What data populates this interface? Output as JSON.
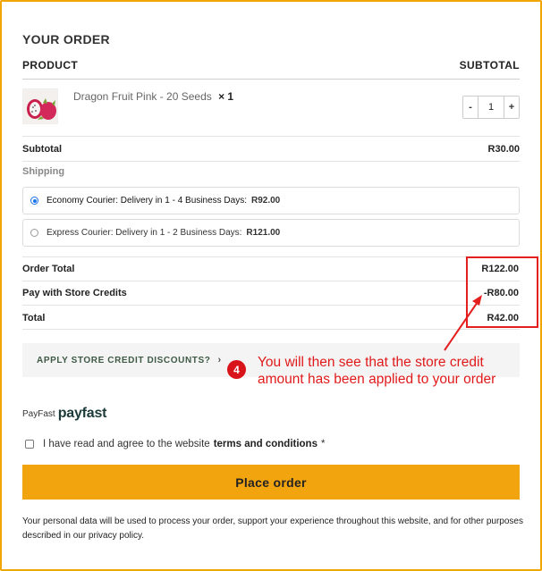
{
  "order": {
    "title": "YOUR ORDER",
    "col_product": "PRODUCT",
    "col_subtotal": "SUBTOTAL"
  },
  "product": {
    "name": "Dragon Fruit Pink - 20 Seeds",
    "qty_label": "× 1",
    "stepper_minus": "-",
    "stepper_value": "1",
    "stepper_plus": "+",
    "image_icon": "dragon-fruit-thumbnail"
  },
  "totals": {
    "subtotal_label": "Subtotal",
    "subtotal_value": "R30.00",
    "shipping_label": "Shipping",
    "order_total_label": "Order Total",
    "order_total_value": "R122.00",
    "store_credit_label": "Pay with Store Credits",
    "store_credit_value": "-R80.00",
    "total_label": "Total",
    "total_value": "R42.00"
  },
  "shipping_options": [
    {
      "name": "Economy Courier: Delivery in 1 - 4 Business Days:",
      "price": "R92.00",
      "selected": true
    },
    {
      "name": "Express Courier: Delivery in 1 - 2 Business Days:",
      "price": "R121.00",
      "selected": false
    }
  ],
  "coupon": {
    "label": "APPLY STORE CREDIT DISCOUNTS?",
    "chevron": "›"
  },
  "callout": {
    "number": "4",
    "text": "You will then see that the store credit amount has been applied to your order",
    "color": "#e01a1a"
  },
  "payment": {
    "method_label": "PayFast",
    "logo_text": "payfast"
  },
  "terms": {
    "text": "I have read and agree to the website",
    "link": "terms and conditions",
    "required": "*"
  },
  "place_order": {
    "label": "Place order",
    "color": "#f2a40f"
  },
  "privacy_text": "Your personal data will be used to process your order, support your experience throughout this website, and for other purposes described in our privacy policy."
}
